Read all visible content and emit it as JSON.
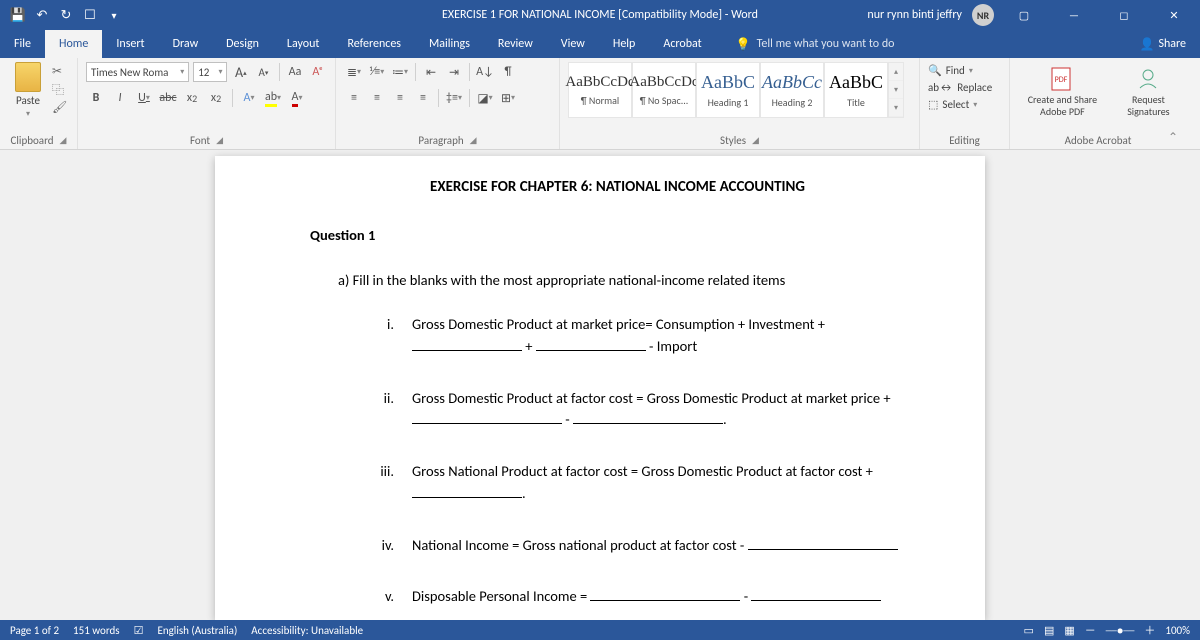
{
  "titlebar": {
    "title": "EXERCISE 1 FOR NATIONAL INCOME [Compatibility Mode]  -  Word",
    "user_name": "nur rynn binti jeffry",
    "user_initials": "NR"
  },
  "tabs": {
    "file": "File",
    "home": "Home",
    "insert": "Insert",
    "draw": "Draw",
    "design": "Design",
    "layout": "Layout",
    "references": "References",
    "mailings": "Mailings",
    "review": "Review",
    "view": "View",
    "help": "Help",
    "acrobat": "Acrobat",
    "tellme": "Tell me what you want to do",
    "share": "Share"
  },
  "ribbon": {
    "clipboard": {
      "label": "Clipboard",
      "paste": "Paste"
    },
    "font": {
      "label": "Font",
      "name": "Times New Roma",
      "size": "12",
      "caseBtn": "Aa"
    },
    "paragraph": {
      "label": "Paragraph"
    },
    "styles": {
      "label": "Styles",
      "items": [
        {
          "sample": "AaBbCcDc",
          "name": "¶ Normal"
        },
        {
          "sample": "AaBbCcDc",
          "name": "¶ No Spac..."
        },
        {
          "sample": "AaBbC",
          "name": "Heading 1"
        },
        {
          "sample": "AaBbCc",
          "name": "Heading 2"
        },
        {
          "sample": "AaBbC",
          "name": "Title"
        }
      ]
    },
    "editing": {
      "label": "Editing",
      "find": "Find",
      "replace": "Replace",
      "select": "Select"
    },
    "acrobat": {
      "label": "Adobe Acrobat",
      "create": "Create and Share Adobe PDF",
      "request": "Request Signatures"
    }
  },
  "doc": {
    "title": "EXERCISE FOR CHAPTER 6: NATIONAL INCOME ACCOUNTING",
    "q1": "Question 1",
    "a": "a)   Fill in the blanks with the most appropriate national-income related items",
    "i_num": "i.",
    "i_l1": "Gross Domestic Product at market price= Consumption + Investment +",
    "i_l2a": " + ",
    "i_l2b": " - Import",
    "ii_num": "ii.",
    "ii_l1": "Gross Domestic Product at factor cost = Gross Domestic Product at market price +",
    "ii_dash": " - ",
    "iii_num": "iii.",
    "iii_l1": "Gross National Product at factor cost = Gross Domestic Product at factor cost +",
    "iv_num": "iv.",
    "iv_l1": "National Income = Gross national product at factor cost - ",
    "v_num": "v.",
    "v_l1": "Disposable Personal Income = ",
    "v_dash": " - "
  },
  "status": {
    "page": "Page 1 of 2",
    "words": "151 words",
    "lang": "English (Australia)",
    "acc": "Accessibility: Unavailable",
    "zoom": "100%"
  }
}
